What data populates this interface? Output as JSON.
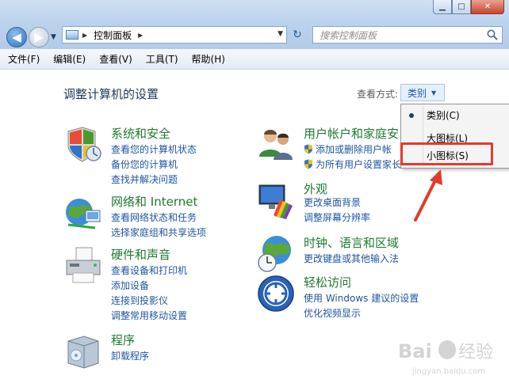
{
  "window": {
    "minimize_glyph": "▁",
    "maximize_glyph": "□",
    "close_glyph": "✕"
  },
  "nav": {
    "back_glyph": "◀",
    "forward_glyph": "▶",
    "dropdown_glyph": "▼"
  },
  "address": {
    "separator": "▶",
    "current": "控制面板",
    "separator_after": "▶",
    "dropdown_glyph": "▼",
    "refresh_glyph": "↻"
  },
  "search": {
    "placeholder": "搜索控制面板"
  },
  "menu": {
    "file": "文件(F)",
    "edit": "编辑(E)",
    "view": "查看(V)",
    "tools": "工具(T)",
    "help": "帮助(H)"
  },
  "main": {
    "title": "调整计算机的设置",
    "view_by_label": "查看方式:",
    "view_by_value": "类别",
    "view_by_glyph": "▼"
  },
  "view_menu": {
    "items": [
      "类别(C)",
      "大图标(L)",
      "小图标(S)"
    ],
    "selected_index": 0
  },
  "categories_left": [
    {
      "title": "系统和安全",
      "links": [
        "查看您的计算机状态",
        "备份您的计算机",
        "查找并解决问题"
      ]
    },
    {
      "title": "网络和 Internet",
      "links": [
        "查看网络状态和任务",
        "选择家庭组和共享选项"
      ]
    },
    {
      "title": "硬件和声音",
      "links": [
        "查看设备和打印机",
        "添加设备",
        "连接到投影仪",
        "调整常用移动设置"
      ]
    },
    {
      "title": "程序",
      "links": [
        "卸载程序"
      ]
    }
  ],
  "categories_right": [
    {
      "title": "用户帐户和家庭安",
      "links": [
        "添加或删除用户帐",
        "为所有用户设置家长"
      ]
    },
    {
      "title": "外观",
      "links": [
        "更改桌面背景",
        "调整屏幕分辨率"
      ]
    },
    {
      "title": "时钟、语言和区域",
      "links": [
        "更改键盘或其他输入法"
      ]
    },
    {
      "title": "轻松访问",
      "links": [
        "使用 Windows 建议的设置",
        "优化视频显示"
      ]
    }
  ],
  "colors": {
    "category_title": "#1e7a2e",
    "link": "#1f55a4",
    "annotation_red": "#e33b2c"
  }
}
